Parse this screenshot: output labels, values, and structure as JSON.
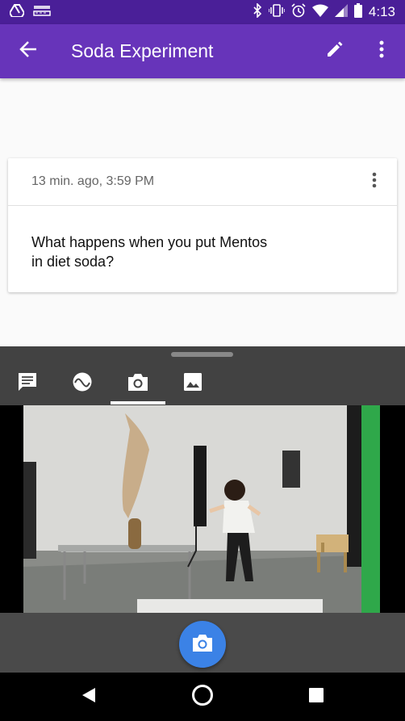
{
  "status_bar": {
    "time": "4:13",
    "icons": [
      "drive-icon",
      "amazon-icon",
      "bluetooth-icon",
      "vibrate-icon",
      "alarm-icon",
      "wifi-icon",
      "signal-icon",
      "battery-icon"
    ]
  },
  "app_bar": {
    "title": "Soda Experiment",
    "icons": [
      "back-arrow-icon",
      "edit-pencil-icon",
      "more-vert-icon"
    ]
  },
  "note": {
    "timestamp": "13 min. ago, 3:59 PM",
    "text": "What happens when you put Mentos in diet soda?"
  },
  "tools": {
    "tabs": [
      {
        "icon": "text-note-icon"
      },
      {
        "icon": "sensor-wave-icon"
      },
      {
        "icon": "camera-icon",
        "selected": true
      },
      {
        "icon": "gallery-icon"
      }
    ]
  },
  "capture": {
    "shutter_icon": "camera-icon",
    "accent": "#3b82e6"
  },
  "nav_bar": {
    "icons": [
      "back-triangle-icon",
      "home-circle-icon",
      "recents-square-icon"
    ]
  },
  "colors": {
    "status_bar": "#4a1f98",
    "app_bar": "#6734ba",
    "panel": "#424242"
  }
}
